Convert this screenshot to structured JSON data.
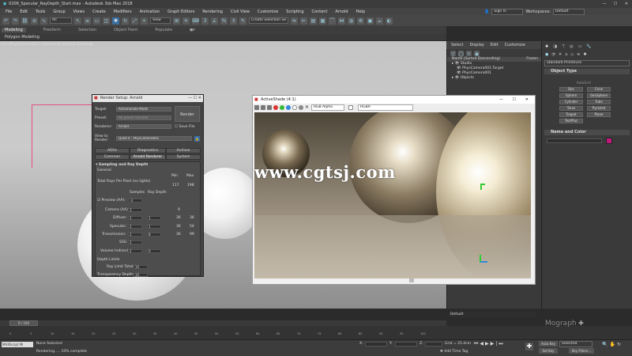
{
  "window": {
    "title": "0206_Specular_RayDepth_Start.max - Autodesk 3ds Max 2018"
  },
  "menu": [
    "File",
    "Edit",
    "Tools",
    "Group",
    "Views",
    "Create",
    "Modifiers",
    "Animation",
    "Graph Editors",
    "Rendering",
    "Civil View",
    "Customize",
    "Scripting",
    "Content",
    "Arnold",
    "Help"
  ],
  "signin": {
    "label": "Sign In",
    "workspaces_label": "Workspaces:",
    "workspace_value": "Default"
  },
  "toolbar": {
    "filter_value": "All",
    "view_value": "View",
    "selection_set": "Create Selection Se"
  },
  "ribbon": {
    "tabs": [
      "Modeling",
      "Freeform",
      "Selection",
      "Object Paint",
      "Populate"
    ],
    "sub": "Polygon Modeling"
  },
  "viewport": {
    "label": "[+] [PhysCamera001] [Standard] [Default Shading]"
  },
  "scene": {
    "menu": [
      "Select",
      "Display",
      "Edit",
      "Customize"
    ],
    "header": "Name (Sorted Descending)",
    "frozen": "Frozen",
    "items": [
      "Studio",
      "PhysCamera001.Target",
      "PhysCamera001",
      "Objects"
    ]
  },
  "command": {
    "dropdown": "Standard Primitives",
    "object_type": "Object Type",
    "autogrid": "AutoGrid",
    "buttons": [
      "Box",
      "Cone",
      "Sphere",
      "GeoSphere",
      "Cylinder",
      "Tube",
      "Torus",
      "Pyramid",
      "Teapot",
      "Plane",
      "TextPlus"
    ],
    "name_color": "Name and Color",
    "accent": "#c2197f"
  },
  "render_setup": {
    "title": "Render Setup: Arnold",
    "target_label": "Target:",
    "target": "ActiveShade Mode",
    "preset_label": "Preset:",
    "preset": "No preset selected",
    "renderer_label": "Renderer:",
    "renderer": "Arnold",
    "save_file": "Save File",
    "view_label": "View to Render:",
    "view": "Quad 4 - PhysCamera001",
    "render_button": "Render",
    "tabs_row1": [
      "AOVs",
      "Diagnostics",
      "Archive"
    ],
    "tabs_row2": [
      "Common",
      "Arnold Renderer",
      "System"
    ],
    "section": "Sampling and Ray Depth",
    "general": "General",
    "min_label": "Min",
    "max_label": "Max",
    "total_rays": "Total Rays Per Pixel (no lights)",
    "total_min": "117",
    "total_max": "198",
    "samples_label": "Samples",
    "ray_depth_label": "Ray Depth",
    "rows": [
      {
        "label": "Preview (AA):",
        "samples": "-3"
      },
      {
        "label": "Camera (AA):",
        "samples": "3",
        "min": "9"
      },
      {
        "label": "Diffuse:",
        "samples": "2",
        "depth": "1",
        "min": "36",
        "max": "36"
      },
      {
        "label": "Specular:",
        "samples": "2",
        "depth": "1",
        "min": "36",
        "max": "54"
      },
      {
        "label": "Transmission:",
        "samples": "2",
        "depth": "8",
        "min": "36",
        "max": "99"
      },
      {
        "label": "SSS:",
        "samples": "2"
      },
      {
        "label": "Volume Indirect:",
        "samples": "2",
        "depth": "0"
      }
    ],
    "depth_limits": "Depth Limits",
    "ray_limit_label": "Ray Limit Total:",
    "ray_limit": "10",
    "transp_label": "Transparency Depth:",
    "transp": "10"
  },
  "activeshade": {
    "title": "ActiveShade (4:1)",
    "channel": "RGB Alpha",
    "display": "RGBA"
  },
  "watermark": "www.cgtsj.com",
  "timeline": {
    "frame": "0 / 100",
    "ticks": [
      "0",
      "5",
      "10",
      "15",
      "20",
      "25",
      "30",
      "35",
      "40",
      "45",
      "50",
      "55",
      "60",
      "65",
      "70",
      "75",
      "80",
      "85",
      "90",
      "95",
      "100"
    ]
  },
  "status": {
    "script": "MAXScript Mi",
    "selection": "None Selected",
    "message": "Rendering..... 10% complete",
    "x_label": "X:",
    "y_label": "Y:",
    "z_label": "Z:",
    "grid": "Grid = 25.4cm",
    "add_time_tag": "Add Time Tag",
    "auto_key": "Auto Key",
    "set_key": "Set Key",
    "selected": "Selected",
    "key_filters": "Key Filters...",
    "default_label": "Default",
    "mograph": "Mograph"
  }
}
